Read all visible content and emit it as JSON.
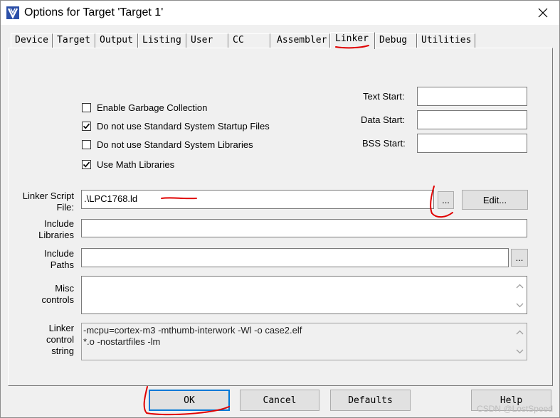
{
  "window": {
    "title": "Options for Target 'Target 1'"
  },
  "tabs": [
    {
      "label": "Device"
    },
    {
      "label": "Target"
    },
    {
      "label": "Output"
    },
    {
      "label": "Listing"
    },
    {
      "label": "User"
    },
    {
      "label": "CC"
    },
    {
      "label": "Assembler"
    },
    {
      "label": "Linker",
      "active": true
    },
    {
      "label": "Debug"
    },
    {
      "label": "Utilities"
    }
  ],
  "linker": {
    "options": [
      {
        "label": "Enable Garbage Collection",
        "checked": false
      },
      {
        "label": "Do not use Standard System Startup Files",
        "checked": true
      },
      {
        "label": "Do not use Standard System Libraries",
        "checked": false
      },
      {
        "label": "Use Math Libraries",
        "checked": true
      }
    ],
    "text_start": {
      "label": "Text Start:",
      "value": ""
    },
    "data_start": {
      "label": "Data Start:",
      "value": ""
    },
    "bss_start": {
      "label": "BSS Start:",
      "value": ""
    },
    "script_file": {
      "label_line1": "Linker Script",
      "label_line2": "File:",
      "value": ".\\LPC1768.ld",
      "browse": "...",
      "edit": "Edit..."
    },
    "include_libraries": {
      "label_line1": "Include",
      "label_line2": "Libraries",
      "value": ""
    },
    "include_paths": {
      "label_line1": "Include",
      "label_line2": "Paths",
      "value": "",
      "browse": "..."
    },
    "misc_controls": {
      "label_line1": "Misc",
      "label_line2": "controls",
      "value": ""
    },
    "control_string": {
      "label_line1": "Linker",
      "label_line2": "control",
      "label_line3": "string",
      "line1": "-mcpu=cortex-m3 -mthumb-interwork -Wl -o case2.elf",
      "line2": "*.o -nostartfiles -lm"
    }
  },
  "buttons": {
    "ok": "OK",
    "cancel": "Cancel",
    "defaults": "Defaults",
    "help": "Help"
  },
  "watermark": "CSDN @LostSpeed",
  "colors": {
    "annotation_ink": "#e00000",
    "default_button_border": "#0078d7"
  }
}
